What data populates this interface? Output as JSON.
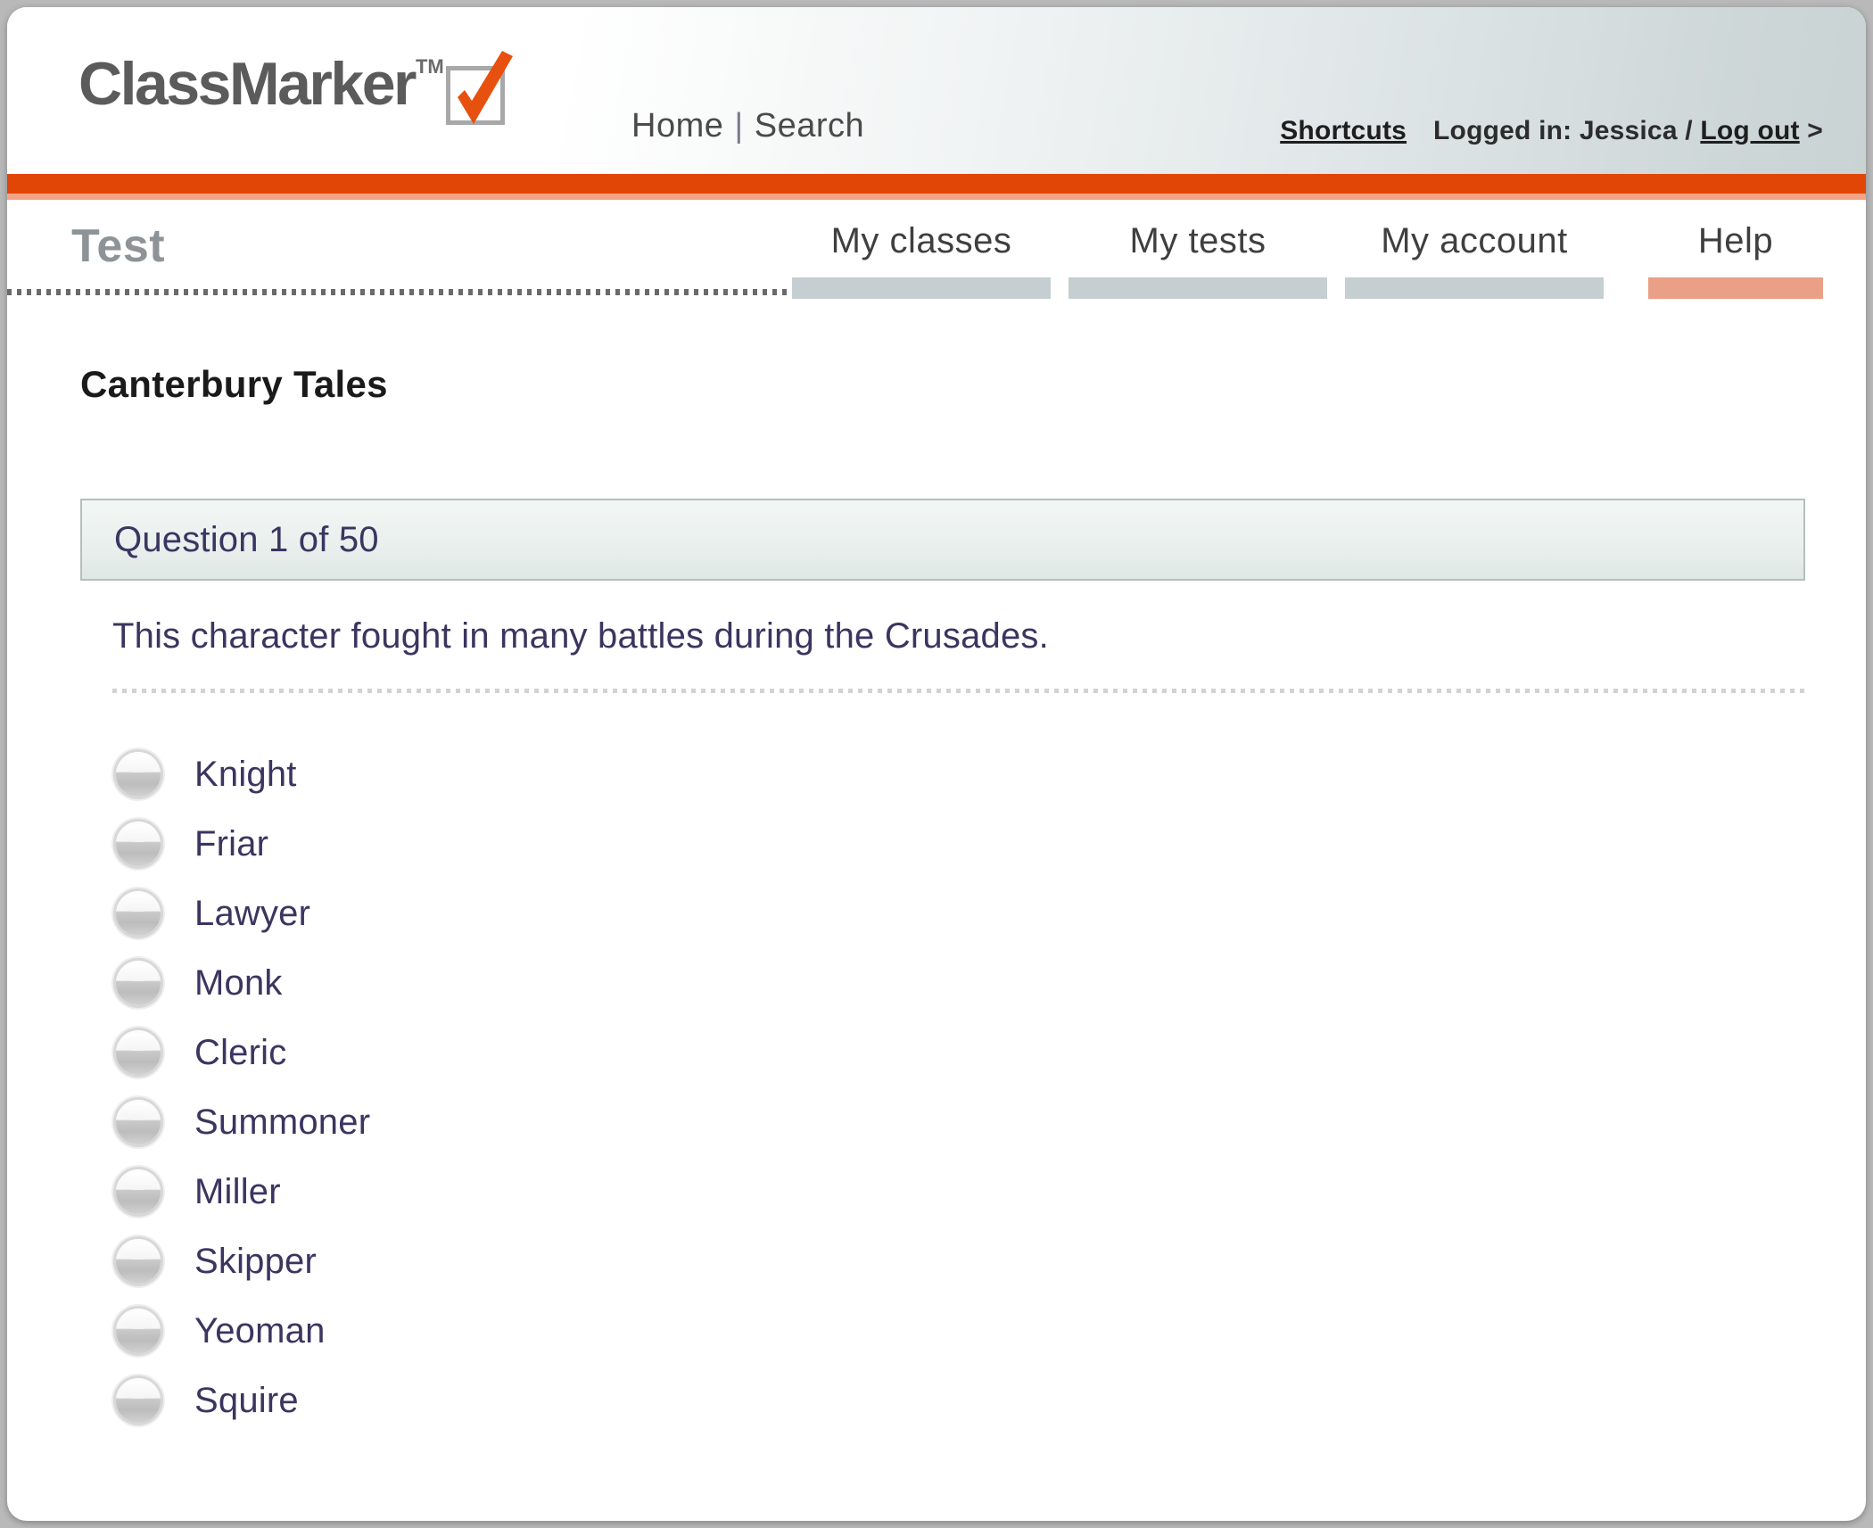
{
  "header": {
    "logo_text": "ClassMarker",
    "logo_tm": "TM",
    "logo_check_icon": "orange-checkmark-icon",
    "nav": {
      "home": "Home",
      "separator": "|",
      "search": "Search"
    },
    "right": {
      "shortcuts": "Shortcuts",
      "logged_in": "Logged in: Jessica",
      "slash": "/",
      "logout": "Log out",
      "arrow": ">"
    },
    "accent_color": "#e24607"
  },
  "nav_bar": {
    "section_title": "Test",
    "tabs": [
      {
        "label": "My classes",
        "active": false
      },
      {
        "label": "My tests",
        "active": false
      },
      {
        "label": "My account",
        "active": false
      },
      {
        "label": "Help",
        "active": true
      }
    ],
    "inactive_tab_color": "#c5cfd1",
    "active_tab_color": "#e9a086"
  },
  "main": {
    "page_title": "Canterbury Tales",
    "question_counter": "Question 1 of 50",
    "question_number": 1,
    "question_total": 50,
    "question_text": "This character fought in many battles during the Crusades.",
    "options": [
      {
        "label": "Knight",
        "selected": false
      },
      {
        "label": "Friar",
        "selected": false
      },
      {
        "label": "Lawyer",
        "selected": false
      },
      {
        "label": "Monk",
        "selected": false
      },
      {
        "label": "Cleric",
        "selected": false
      },
      {
        "label": "Summoner",
        "selected": false
      },
      {
        "label": "Miller",
        "selected": false
      },
      {
        "label": "Skipper",
        "selected": false
      },
      {
        "label": "Yeoman",
        "selected": false
      },
      {
        "label": "Squire",
        "selected": false
      }
    ]
  }
}
